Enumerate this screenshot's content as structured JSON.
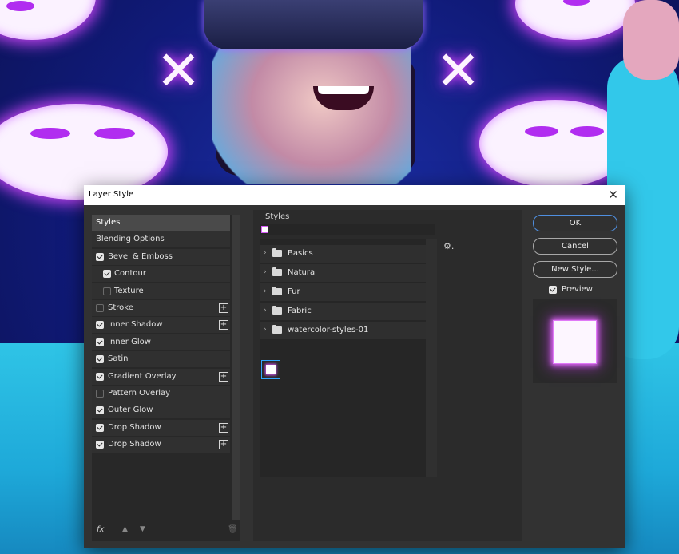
{
  "dialog": {
    "title": "Layer Style",
    "close_glyph": "✕"
  },
  "left_list": [
    {
      "label": "Styles",
      "type": "header",
      "selected": true
    },
    {
      "label": "Blending Options",
      "type": "header"
    },
    {
      "label": "Bevel & Emboss",
      "checked": true
    },
    {
      "label": "Contour",
      "checked": true,
      "indent": true
    },
    {
      "label": "Texture",
      "checked": false,
      "indent": true
    },
    {
      "label": "Stroke",
      "checked": false,
      "add": true
    },
    {
      "label": "Inner Shadow",
      "checked": true,
      "add": true
    },
    {
      "label": "Inner Glow",
      "checked": true
    },
    {
      "label": "Satin",
      "checked": true
    },
    {
      "label": "Gradient Overlay",
      "checked": true,
      "add": true
    },
    {
      "label": "Pattern Overlay",
      "checked": false
    },
    {
      "label": "Outer Glow",
      "checked": true
    },
    {
      "label": "Drop Shadow",
      "checked": true,
      "add": true
    },
    {
      "label": "Drop Shadow",
      "checked": true,
      "add": true
    }
  ],
  "left_footer": {
    "fx": "fx",
    "up": "▲",
    "down": "▼",
    "trash": "🗑"
  },
  "styles_panel": {
    "label": "Styles",
    "gear": "⚙.",
    "folders": [
      "Basics",
      "Natural",
      "Fur",
      "Fabric",
      "watercolor-styles-01"
    ],
    "chevron": "›"
  },
  "buttons": {
    "ok": "OK",
    "cancel": "Cancel",
    "new_style": "New Style..."
  },
  "preview": {
    "label": "Preview",
    "checked": true
  },
  "icons": {
    "fx": "fx-icon",
    "move_up": "arrow-up-icon",
    "move_down": "arrow-down-icon",
    "delete": "trash-icon",
    "settings": "gear-icon",
    "folder": "folder-icon",
    "add": "plus-icon"
  },
  "colors": {
    "dialog_bg": "#323232",
    "accent_blue": "#4f8fe0",
    "glow_purple": "#d353f5"
  }
}
